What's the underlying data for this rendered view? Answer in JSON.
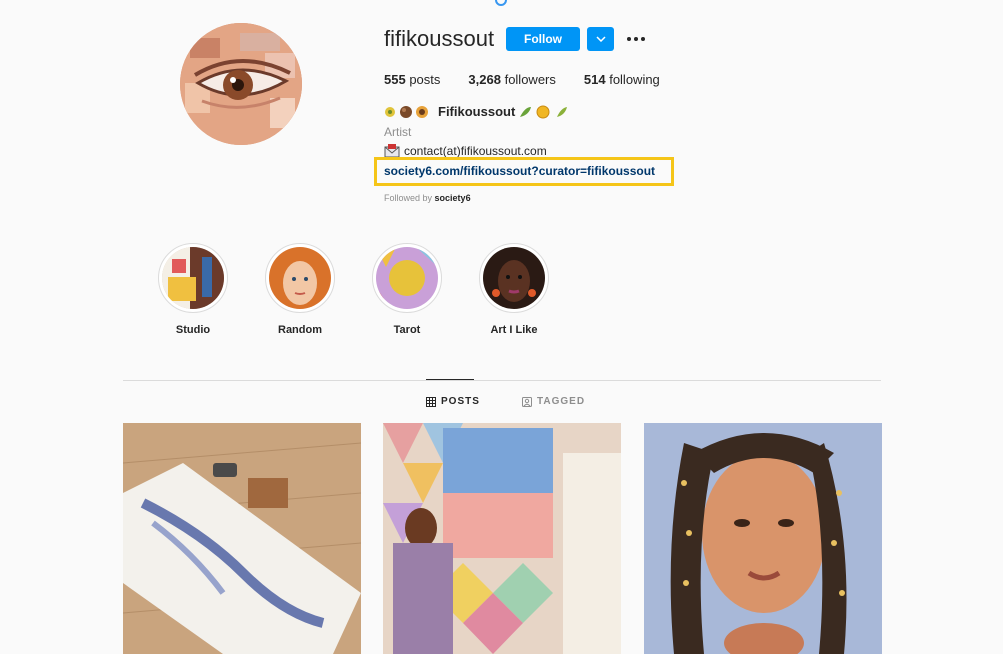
{
  "profile": {
    "username": "fifikoussout",
    "follow_label": "Follow",
    "stats": [
      {
        "count": "555",
        "label": "posts"
      },
      {
        "count": "3,268",
        "label": "followers"
      },
      {
        "count": "514",
        "label": "following"
      }
    ],
    "bio": {
      "name": "Fifikoussout",
      "category": "Artist",
      "contact": "contact(at)fifikoussout.com",
      "link": "society6.com/fifikoussout?curator=fifikoussout",
      "followed_by_prefix": "Followed by",
      "followed_by_user": "society6"
    }
  },
  "highlights": [
    {
      "label": "Studio"
    },
    {
      "label": "Random"
    },
    {
      "label": "Tarot"
    },
    {
      "label": "Art I Like"
    }
  ],
  "tabs": {
    "posts": "POSTS",
    "tagged": "TAGGED"
  },
  "colors": {
    "accent": "#0095f6",
    "link": "#00376b",
    "highlight_box": "#f5c518"
  }
}
